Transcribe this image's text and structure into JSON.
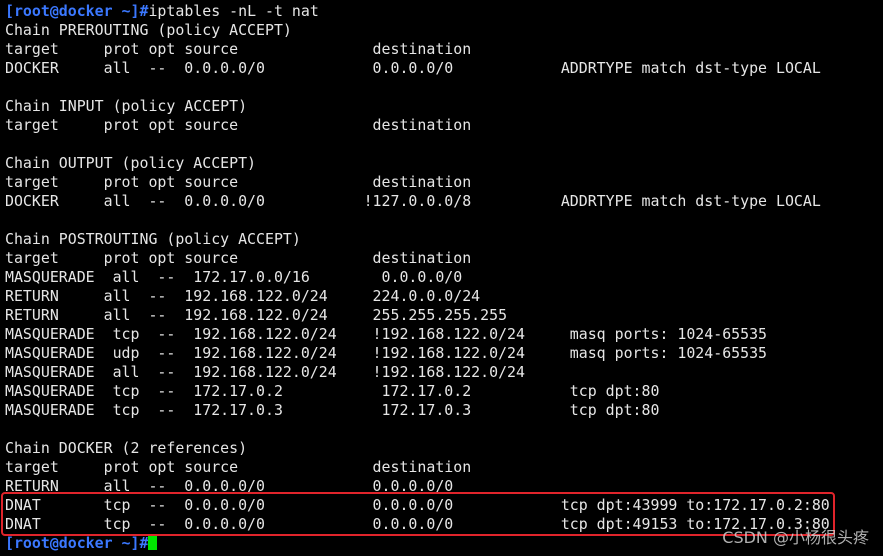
{
  "terminal": {
    "prompt_top": "[root@docker ~]#",
    "command": "iptables -nL -t nat",
    "lines": [
      "Chain PREROUTING (policy ACCEPT)",
      "target     prot opt source               destination",
      "DOCKER     all  --  0.0.0.0/0            0.0.0.0/0            ADDRTYPE match dst-type LOCAL",
      "",
      "Chain INPUT (policy ACCEPT)",
      "target     prot opt source               destination",
      "",
      "Chain OUTPUT (policy ACCEPT)",
      "target     prot opt source               destination",
      "DOCKER     all  --  0.0.0.0/0           !127.0.0.0/8          ADDRTYPE match dst-type LOCAL",
      "",
      "Chain POSTROUTING (policy ACCEPT)",
      "target     prot opt source               destination",
      "MASQUERADE  all  --  172.17.0.0/16        0.0.0.0/0",
      "RETURN     all  --  192.168.122.0/24     224.0.0.0/24",
      "RETURN     all  --  192.168.122.0/24     255.255.255.255",
      "MASQUERADE  tcp  --  192.168.122.0/24    !192.168.122.0/24     masq ports: 1024-65535",
      "MASQUERADE  udp  --  192.168.122.0/24    !192.168.122.0/24     masq ports: 1024-65535",
      "MASQUERADE  all  --  192.168.122.0/24    !192.168.122.0/24",
      "MASQUERADE  tcp  --  172.17.0.2           172.17.0.2           tcp dpt:80",
      "MASQUERADE  tcp  --  172.17.0.3           172.17.0.3           tcp dpt:80",
      "",
      "Chain DOCKER (2 references)",
      "target     prot opt source               destination",
      "RETURN     all  --  0.0.0.0/0            0.0.0.0/0",
      "DNAT       tcp  --  0.0.0.0/0            0.0.0.0/0            tcp dpt:43999 to:172.17.0.2:80",
      "DNAT       tcp  --  0.0.0.0/0            0.0.0.0/0            tcp dpt:49153 to:172.17.0.3:80"
    ],
    "prompt_bottom": "[root@docker ~]#"
  },
  "watermark": "CSDN @小杨很头疼",
  "colors": {
    "background": "#000000",
    "text": "#e6e6e6",
    "prompt": "#3b78ff",
    "cursor": "#00e600",
    "highlight": "#e0242b"
  }
}
